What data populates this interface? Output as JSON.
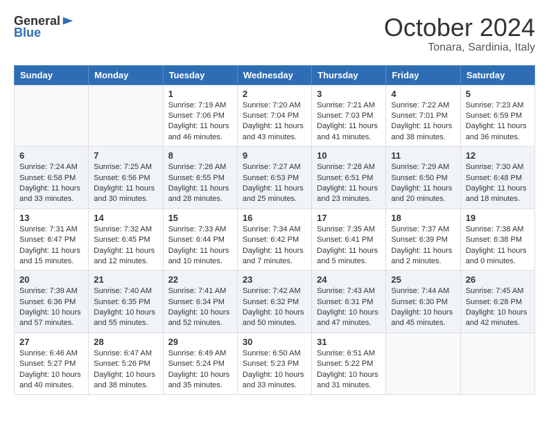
{
  "header": {
    "logo_general": "General",
    "logo_blue": "Blue",
    "month": "October 2024",
    "location": "Tonara, Sardinia, Italy"
  },
  "weekdays": [
    "Sunday",
    "Monday",
    "Tuesday",
    "Wednesday",
    "Thursday",
    "Friday",
    "Saturday"
  ],
  "weeks": [
    [
      {
        "day": "",
        "info": ""
      },
      {
        "day": "",
        "info": ""
      },
      {
        "day": "1",
        "info": "Sunrise: 7:19 AM\nSunset: 7:06 PM\nDaylight: 11 hours and 46 minutes."
      },
      {
        "day": "2",
        "info": "Sunrise: 7:20 AM\nSunset: 7:04 PM\nDaylight: 11 hours and 43 minutes."
      },
      {
        "day": "3",
        "info": "Sunrise: 7:21 AM\nSunset: 7:03 PM\nDaylight: 11 hours and 41 minutes."
      },
      {
        "day": "4",
        "info": "Sunrise: 7:22 AM\nSunset: 7:01 PM\nDaylight: 11 hours and 38 minutes."
      },
      {
        "day": "5",
        "info": "Sunrise: 7:23 AM\nSunset: 6:59 PM\nDaylight: 11 hours and 36 minutes."
      }
    ],
    [
      {
        "day": "6",
        "info": "Sunrise: 7:24 AM\nSunset: 6:58 PM\nDaylight: 11 hours and 33 minutes."
      },
      {
        "day": "7",
        "info": "Sunrise: 7:25 AM\nSunset: 6:56 PM\nDaylight: 11 hours and 30 minutes."
      },
      {
        "day": "8",
        "info": "Sunrise: 7:26 AM\nSunset: 6:55 PM\nDaylight: 11 hours and 28 minutes."
      },
      {
        "day": "9",
        "info": "Sunrise: 7:27 AM\nSunset: 6:53 PM\nDaylight: 11 hours and 25 minutes."
      },
      {
        "day": "10",
        "info": "Sunrise: 7:28 AM\nSunset: 6:51 PM\nDaylight: 11 hours and 23 minutes."
      },
      {
        "day": "11",
        "info": "Sunrise: 7:29 AM\nSunset: 6:50 PM\nDaylight: 11 hours and 20 minutes."
      },
      {
        "day": "12",
        "info": "Sunrise: 7:30 AM\nSunset: 6:48 PM\nDaylight: 11 hours and 18 minutes."
      }
    ],
    [
      {
        "day": "13",
        "info": "Sunrise: 7:31 AM\nSunset: 6:47 PM\nDaylight: 11 hours and 15 minutes."
      },
      {
        "day": "14",
        "info": "Sunrise: 7:32 AM\nSunset: 6:45 PM\nDaylight: 11 hours and 12 minutes."
      },
      {
        "day": "15",
        "info": "Sunrise: 7:33 AM\nSunset: 6:44 PM\nDaylight: 11 hours and 10 minutes."
      },
      {
        "day": "16",
        "info": "Sunrise: 7:34 AM\nSunset: 6:42 PM\nDaylight: 11 hours and 7 minutes."
      },
      {
        "day": "17",
        "info": "Sunrise: 7:35 AM\nSunset: 6:41 PM\nDaylight: 11 hours and 5 minutes."
      },
      {
        "day": "18",
        "info": "Sunrise: 7:37 AM\nSunset: 6:39 PM\nDaylight: 11 hours and 2 minutes."
      },
      {
        "day": "19",
        "info": "Sunrise: 7:38 AM\nSunset: 6:38 PM\nDaylight: 11 hours and 0 minutes."
      }
    ],
    [
      {
        "day": "20",
        "info": "Sunrise: 7:39 AM\nSunset: 6:36 PM\nDaylight: 10 hours and 57 minutes."
      },
      {
        "day": "21",
        "info": "Sunrise: 7:40 AM\nSunset: 6:35 PM\nDaylight: 10 hours and 55 minutes."
      },
      {
        "day": "22",
        "info": "Sunrise: 7:41 AM\nSunset: 6:34 PM\nDaylight: 10 hours and 52 minutes."
      },
      {
        "day": "23",
        "info": "Sunrise: 7:42 AM\nSunset: 6:32 PM\nDaylight: 10 hours and 50 minutes."
      },
      {
        "day": "24",
        "info": "Sunrise: 7:43 AM\nSunset: 6:31 PM\nDaylight: 10 hours and 47 minutes."
      },
      {
        "day": "25",
        "info": "Sunrise: 7:44 AM\nSunset: 6:30 PM\nDaylight: 10 hours and 45 minutes."
      },
      {
        "day": "26",
        "info": "Sunrise: 7:45 AM\nSunset: 6:28 PM\nDaylight: 10 hours and 42 minutes."
      }
    ],
    [
      {
        "day": "27",
        "info": "Sunrise: 6:46 AM\nSunset: 5:27 PM\nDaylight: 10 hours and 40 minutes."
      },
      {
        "day": "28",
        "info": "Sunrise: 6:47 AM\nSunset: 5:26 PM\nDaylight: 10 hours and 38 minutes."
      },
      {
        "day": "29",
        "info": "Sunrise: 6:49 AM\nSunset: 5:24 PM\nDaylight: 10 hours and 35 minutes."
      },
      {
        "day": "30",
        "info": "Sunrise: 6:50 AM\nSunset: 5:23 PM\nDaylight: 10 hours and 33 minutes."
      },
      {
        "day": "31",
        "info": "Sunrise: 6:51 AM\nSunset: 5:22 PM\nDaylight: 10 hours and 31 minutes."
      },
      {
        "day": "",
        "info": ""
      },
      {
        "day": "",
        "info": ""
      }
    ]
  ]
}
